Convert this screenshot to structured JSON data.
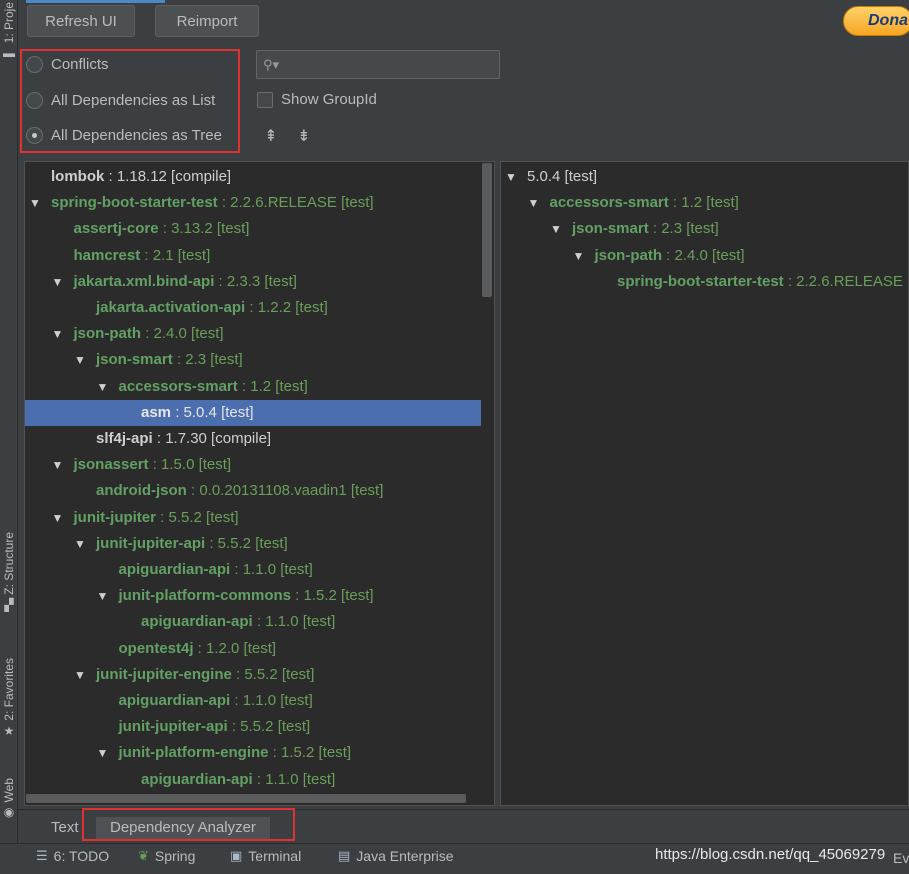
{
  "side_tabs": {
    "project": "1: Proje",
    "structure": "Z: Structure",
    "favorites": "2: Favorites",
    "web": "Web"
  },
  "toolbar": {
    "refresh_label": "Refresh UI",
    "reimport_label": "Reimport",
    "donate_label": "Dona"
  },
  "view_mode": {
    "options": [
      "Conflicts",
      "All Dependencies as List",
      "All Dependencies as Tree"
    ],
    "selected": "All Dependencies as Tree"
  },
  "search": {
    "placeholder": "",
    "value": ""
  },
  "show_groupid": {
    "label": "Show GroupId",
    "checked": false
  },
  "left_tree": [
    {
      "name": "lombok",
      "rest": " : 1.18.12 [compile]",
      "arrow": false,
      "style": "white",
      "selected": false,
      "depth": 0
    },
    {
      "name": "spring-boot-starter-test",
      "rest": " : 2.2.6.RELEASE [test]",
      "arrow": true,
      "style": "green",
      "selected": false,
      "depth": 0
    },
    {
      "name": "assertj-core",
      "rest": " : 3.13.2 [test]",
      "arrow": false,
      "style": "green",
      "selected": false,
      "depth": 1
    },
    {
      "name": "hamcrest",
      "rest": " : 2.1 [test]",
      "arrow": false,
      "style": "green",
      "selected": false,
      "depth": 1
    },
    {
      "name": "jakarta.xml.bind-api",
      "rest": " : 2.3.3 [test]",
      "arrow": true,
      "style": "green",
      "selected": false,
      "depth": 1
    },
    {
      "name": "jakarta.activation-api",
      "rest": " : 1.2.2 [test]",
      "arrow": false,
      "style": "green",
      "selected": false,
      "depth": 2
    },
    {
      "name": "json-path",
      "rest": " : 2.4.0 [test]",
      "arrow": true,
      "style": "green",
      "selected": false,
      "depth": 1
    },
    {
      "name": "json-smart",
      "rest": " : 2.3 [test]",
      "arrow": true,
      "style": "green",
      "selected": false,
      "depth": 2
    },
    {
      "name": "accessors-smart",
      "rest": " : 1.2 [test]",
      "arrow": true,
      "style": "green",
      "selected": false,
      "depth": 3
    },
    {
      "name": "asm",
      "rest": " : 5.0.4 [test]",
      "arrow": false,
      "style": "green",
      "selected": true,
      "depth": 4
    },
    {
      "name": "slf4j-api",
      "rest": " : 1.7.30 [compile]",
      "arrow": false,
      "style": "white",
      "selected": false,
      "depth": 2
    },
    {
      "name": "jsonassert",
      "rest": " : 1.5.0 [test]",
      "arrow": true,
      "style": "green",
      "selected": false,
      "depth": 1
    },
    {
      "name": "android-json",
      "rest": " : 0.0.20131108.vaadin1 [test]",
      "arrow": false,
      "style": "green",
      "selected": false,
      "depth": 2
    },
    {
      "name": "junit-jupiter",
      "rest": " : 5.5.2 [test]",
      "arrow": true,
      "style": "green",
      "selected": false,
      "depth": 1
    },
    {
      "name": "junit-jupiter-api",
      "rest": " : 5.5.2 [test]",
      "arrow": true,
      "style": "green",
      "selected": false,
      "depth": 2
    },
    {
      "name": "apiguardian-api",
      "rest": " : 1.1.0 [test]",
      "arrow": false,
      "style": "green",
      "selected": false,
      "depth": 3
    },
    {
      "name": "junit-platform-commons",
      "rest": " : 1.5.2 [test]",
      "arrow": true,
      "style": "green",
      "selected": false,
      "depth": 3
    },
    {
      "name": "apiguardian-api",
      "rest": " : 1.1.0 [test]",
      "arrow": false,
      "style": "green",
      "selected": false,
      "depth": 4
    },
    {
      "name": "opentest4j",
      "rest": " : 1.2.0 [test]",
      "arrow": false,
      "style": "green",
      "selected": false,
      "depth": 3
    },
    {
      "name": "junit-jupiter-engine",
      "rest": " : 5.5.2 [test]",
      "arrow": true,
      "style": "green",
      "selected": false,
      "depth": 2
    },
    {
      "name": "apiguardian-api",
      "rest": " : 1.1.0 [test]",
      "arrow": false,
      "style": "green",
      "selected": false,
      "depth": 3
    },
    {
      "name": "junit-jupiter-api",
      "rest": " : 5.5.2 [test]",
      "arrow": false,
      "style": "green",
      "selected": false,
      "depth": 3
    },
    {
      "name": "junit-platform-engine",
      "rest": " : 1.5.2 [test]",
      "arrow": true,
      "style": "green",
      "selected": false,
      "depth": 3
    },
    {
      "name": "apiguardian-api",
      "rest": " : 1.1.0 [test]",
      "arrow": false,
      "style": "green",
      "selected": false,
      "depth": 4
    }
  ],
  "right_tree": [
    {
      "name": "",
      "rest": "5.0.4 [test]",
      "arrow": true,
      "style": "white",
      "depth": 0
    },
    {
      "name": "accessors-smart",
      "rest": " : 1.2 [test]",
      "arrow": true,
      "style": "green",
      "depth": 1
    },
    {
      "name": "json-smart",
      "rest": " : 2.3 [test]",
      "arrow": true,
      "style": "green",
      "depth": 2
    },
    {
      "name": "json-path",
      "rest": " : 2.4.0 [test]",
      "arrow": true,
      "style": "green",
      "depth": 3
    },
    {
      "name": "spring-boot-starter-test",
      "rest": " : 2.2.6.RELEASE",
      "arrow": false,
      "style": "green",
      "depth": 4
    }
  ],
  "bottom_tabs": {
    "text": "Text",
    "dependency_analyzer": "Dependency Analyzer"
  },
  "status_bar": {
    "todo": "6: TODO",
    "spring": "Spring",
    "terminal": "Terminal",
    "java_enterprise": "Java Enterprise",
    "watermark": "https://blog.csdn.net/qq_45069279",
    "trailing": "Ev"
  }
}
